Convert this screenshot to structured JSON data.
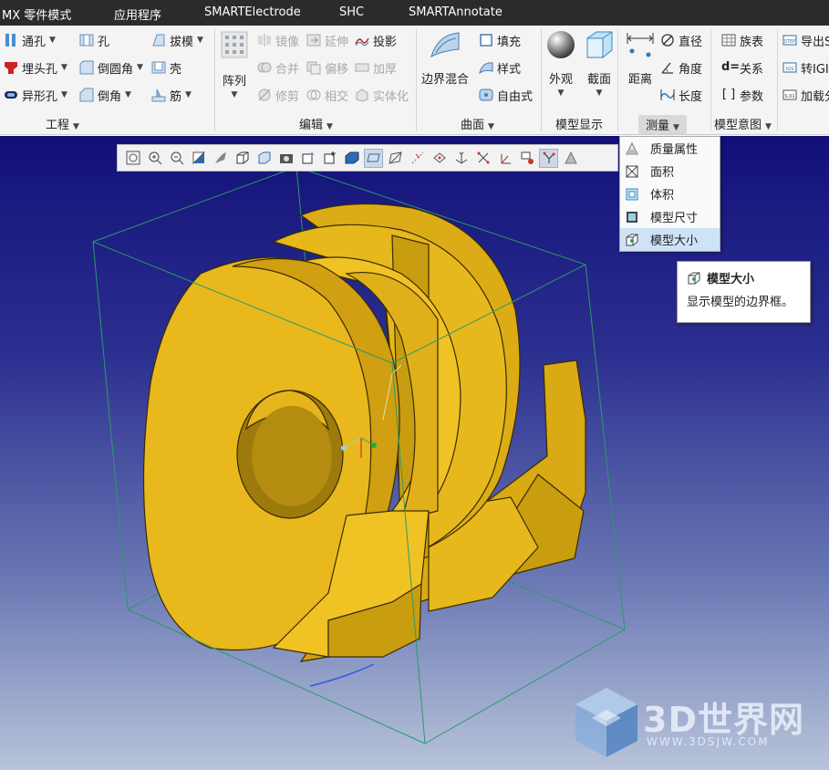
{
  "tabs": [
    {
      "label": "MX 零件模式"
    },
    {
      "label": "应用程序"
    },
    {
      "label": "SMARTElectrode"
    },
    {
      "label": "SHC"
    },
    {
      "label": "SMARTAnnotate"
    }
  ],
  "ribbon": {
    "engineering": {
      "label": "工程",
      "items": [
        "通孔",
        "孔",
        "拔模",
        "埋头孔",
        "倒圆角",
        "壳",
        "异形孔",
        "倒角",
        "筋"
      ]
    },
    "edit": {
      "label": "编辑",
      "array": "阵列",
      "items": [
        "镜像",
        "延伸",
        "投影",
        "合并",
        "偏移",
        "加厚",
        "修剪",
        "相交",
        "实体化"
      ]
    },
    "surface": {
      "label": "曲面",
      "boundary_blend": "边界混合",
      "items": [
        "填充",
        "样式",
        "自由式"
      ]
    },
    "model_display": {
      "label": "模型显示",
      "appearance": "外观",
      "section": "截面"
    },
    "measure": {
      "label": "测量",
      "distance": "距离",
      "items": [
        "直径",
        "角度",
        "长度"
      ]
    },
    "model_intent": {
      "label": "模型意图",
      "items": [
        "族表",
        "关系",
        "参数"
      ]
    },
    "export": {
      "items": [
        "导出S",
        "转IGI",
        "加载分"
      ]
    }
  },
  "measure_menu": {
    "items": [
      {
        "label": "质量属性",
        "icon": "mass-properties-icon"
      },
      {
        "label": "面积",
        "icon": "area-icon"
      },
      {
        "label": "体积",
        "icon": "volume-icon"
      },
      {
        "label": "模型尺寸",
        "icon": "model-dimension-icon"
      },
      {
        "label": "模型大小",
        "icon": "model-size-icon",
        "highlighted": true
      }
    ]
  },
  "tooltip": {
    "title": "模型大小",
    "description": "显示模型的边界框。"
  },
  "watermark": {
    "text": "3D世界网",
    "url": "WWW.3DSJW.COM"
  },
  "colors": {
    "model_yellow": "#e2b51a",
    "viewport_top": "#121078",
    "viewport_bottom": "#b8c4da",
    "bbox_green": "#2a9a6a",
    "ribbon_bg": "#f4f4f4",
    "highlight": "#cfe3f6"
  }
}
